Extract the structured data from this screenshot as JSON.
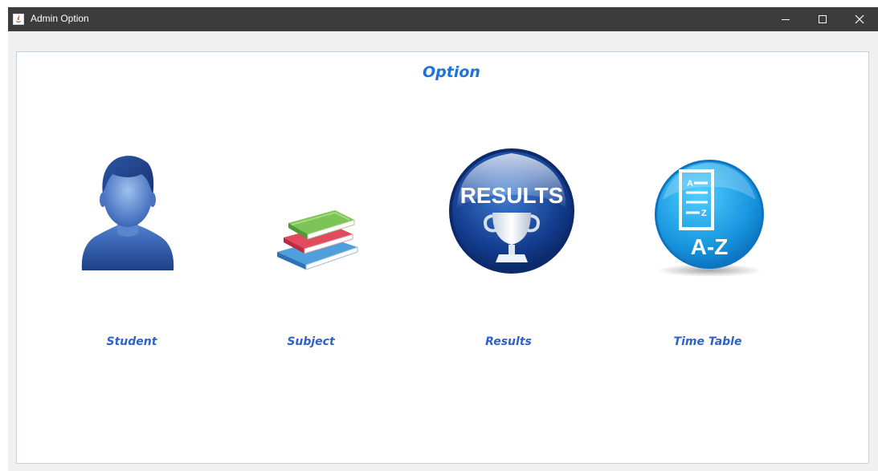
{
  "window": {
    "title": "Admin Option",
    "controls": {
      "minimize": "minimize",
      "maximize": "maximize",
      "close": "close"
    }
  },
  "panel": {
    "legend": "Option"
  },
  "options": [
    {
      "label": "Student",
      "icon": "student-icon"
    },
    {
      "label": "Subject",
      "icon": "books-icon"
    },
    {
      "label": "Results",
      "icon": "results-trophy-icon",
      "icon_text": "RESULTS"
    },
    {
      "label": "Time Table",
      "icon": "timetable-az-icon",
      "icon_text": "A-Z",
      "icon_small_a": "A",
      "icon_small_z": "Z"
    }
  ],
  "colors": {
    "titlebar": "#3c3c3c",
    "legend_text": "#1e73dc",
    "label_text": "#2d63c8",
    "panel_border": "#c3d1de"
  }
}
